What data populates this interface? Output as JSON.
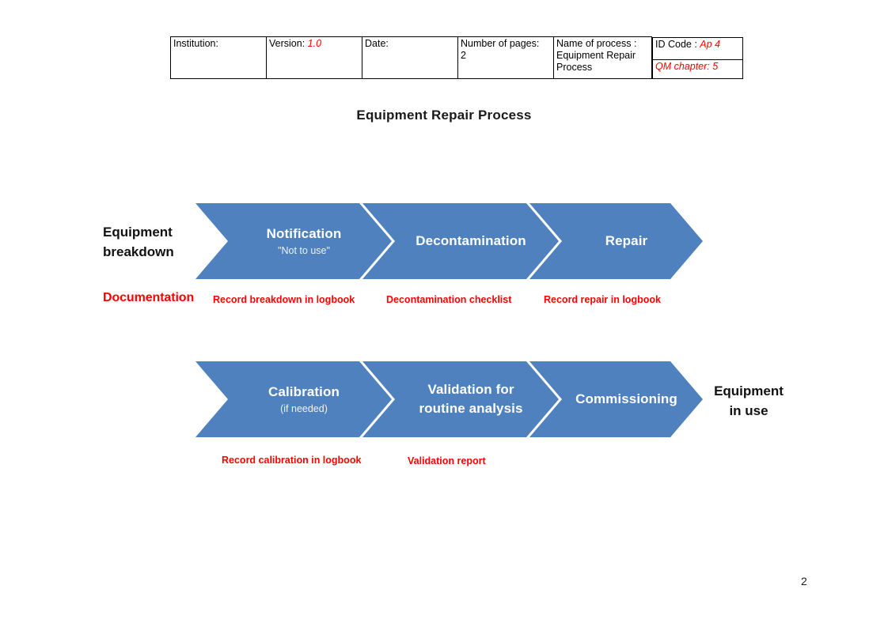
{
  "document": {
    "page_number": "2",
    "slide_title": "Equipment Repair Process"
  },
  "header_table": {
    "cells": {
      "institution_label": "Institution:",
      "version_label": "Version:",
      "version_value": "1.0",
      "date_label": "Date:",
      "pages_label": "Number of pages:",
      "pages_value": "2",
      "process_label": "Name of process :",
      "process_value": "Equipment Repair Process",
      "id_code_label": "ID Code :",
      "id_code_value": "Ap 4",
      "qm_chapter_text": "QM chapter: 5"
    }
  },
  "flow": {
    "accent_color": "#4E81BD",
    "annotation_color": "#ff0000",
    "start_label": "Equipment\nbreakdown",
    "start_label_line1": "Equipment",
    "start_label_line2": "breakdown",
    "end_label_line1": "Equipment",
    "end_label_line2": "in use",
    "documentation_heading": "Documentation",
    "row1": {
      "steps": [
        {
          "title": "Notification",
          "subtitle": "\"Not to use\"",
          "note": "Record breakdown in logbook"
        },
        {
          "title": "Decontamination",
          "subtitle": "",
          "note": "Decontamination checklist"
        },
        {
          "title": "Repair",
          "subtitle": "",
          "note": "Record repair in logbook"
        }
      ]
    },
    "row2": {
      "steps": [
        {
          "title": "Calibration",
          "subtitle": "(if needed)",
          "note": "Record calibration in logbook"
        },
        {
          "title_line1": "Validation for",
          "title_line2": "routine analysis",
          "subtitle": "",
          "note": "Validation report"
        },
        {
          "title": "Commissioning",
          "subtitle": "",
          "note": ""
        }
      ]
    }
  }
}
